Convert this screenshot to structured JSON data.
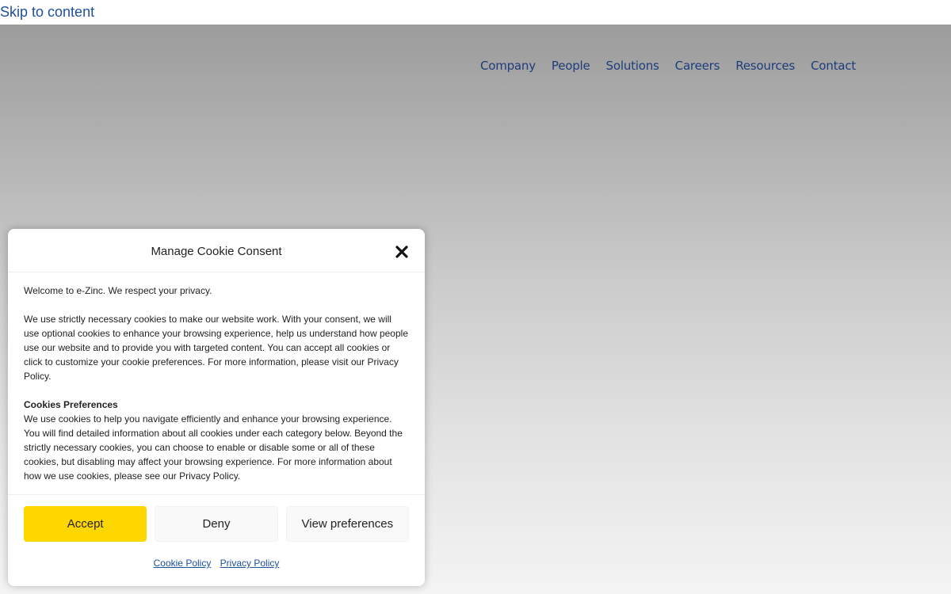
{
  "skip_link": "Skip to content",
  "nav": {
    "items": [
      "Company",
      "People",
      "Solutions",
      "Careers",
      "Resources",
      "Contact"
    ]
  },
  "cookie_modal": {
    "title": "Manage Cookie Consent",
    "welcome": "Welcome to e-Zinc. We respect your privacy.",
    "intro": "We use strictly necessary cookies to make our website work. With your consent, we will use optional cookies to enhance your browsing experience, help us understand how people use our website and to provide you with targeted content. You can accept all cookies or click to customize your cookie preferences. For more information, please visit our Privacy Policy.",
    "prefs_heading": "Cookies Preferences",
    "prefs_text": "We use cookies to help you navigate efficiently and enhance your browsing experience. You will find detailed information about all cookies under each category below. Beyond the strictly necessary cookies, you can choose to enable or disable some or all of these cookies, but disabling may affect your browsing experience. For more information about how we use cookies, please see our Privacy Policy.",
    "buttons": {
      "accept": "Accept",
      "deny": "Deny",
      "preferences": "View preferences"
    },
    "links": {
      "cookie_policy": "Cookie Policy",
      "privacy_policy": "Privacy Policy"
    }
  },
  "colors": {
    "accent": "#ffd700",
    "link": "#1f4e9c",
    "nav_text": "#1d3d7a"
  },
  "icons": {
    "close": "close-icon"
  }
}
